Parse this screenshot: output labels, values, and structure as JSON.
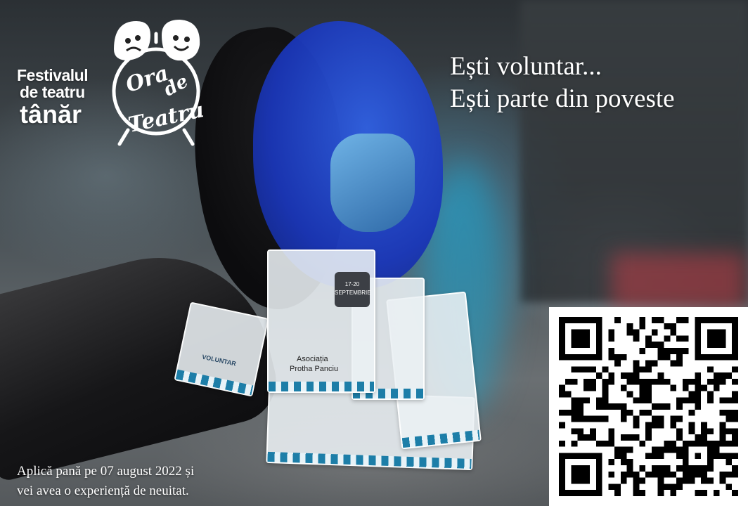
{
  "logo": {
    "line1": "Festivalul",
    "line2": "de teatru",
    "line3": "tânăr",
    "emblem_word1": "Ora",
    "emblem_word2": "de",
    "emblem_word3": "Teatru",
    "emblem_icon": "alarm-clock-theatre-masks-icon"
  },
  "headline": {
    "line1": "Ești voluntar...",
    "line2": "Ești parte din poveste"
  },
  "footer": {
    "line1": "Aplică pană pe 07 august 2022 și",
    "line2": "vei avea o experiență de neuitat."
  },
  "badges": {
    "role": "VOLUNTAR",
    "organization_line1": "Asociația",
    "organization_line2": "Protha Panciu",
    "dates": "17-20",
    "month": "SEPTEMBRIE"
  },
  "qr": {
    "icon": "qr-code-icon"
  },
  "colors": {
    "lanyard_blue": "#1f44d0",
    "lanyard_black": "#111111",
    "text": "#ffffff",
    "badge_accent": "#1d7ea8"
  }
}
